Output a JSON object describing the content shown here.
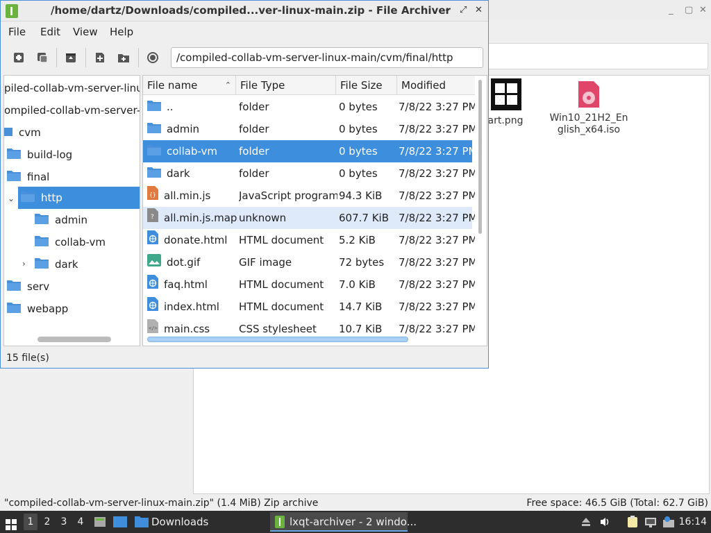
{
  "background_window": {
    "files": [
      {
        "name": "art.png",
        "icon": "windows-logo-image-icon"
      },
      {
        "name": "Win10_21H2_English_x64.iso",
        "line1": "Win10_21H2_En",
        "line2": "glish_x64.iso",
        "icon": "disc-image-icon"
      }
    ],
    "status_left": "\"compiled-collab-vm-server-linux-main.zip\" (1.4 MiB) Zip archive",
    "status_right": "Free space: 46.5 GiB (Total: 62.7 GiB)"
  },
  "archiver": {
    "title": "/home/dartz/Downloads/compiled...ver-linux-main.zip - File Archiver",
    "menu": [
      "File",
      "Edit",
      "View",
      "Help"
    ],
    "path": "/compiled-collab-vm-server-linux-main/cvm/final/http",
    "tree": [
      {
        "label": "piled-collab-vm-server-linux-m",
        "depth": 0,
        "icon": false
      },
      {
        "label": "ompiled-collab-vm-server-linu",
        "depth": 0,
        "icon": false
      },
      {
        "label": "cvm",
        "depth": 0,
        "icon": false
      },
      {
        "label": "build-log",
        "depth": 0,
        "icon": true
      },
      {
        "label": "final",
        "depth": 0,
        "icon": true
      },
      {
        "label": "http",
        "depth": 1,
        "icon": true,
        "selected": true
      },
      {
        "label": "admin",
        "depth": 2,
        "icon": true
      },
      {
        "label": "collab-vm",
        "depth": 2,
        "icon": true
      },
      {
        "label": "dark",
        "depth": 2,
        "icon": true
      },
      {
        "label": "serv",
        "depth": 0,
        "icon": true
      },
      {
        "label": "webapp",
        "depth": 0,
        "icon": true
      }
    ],
    "columns": [
      "File name",
      "File Type",
      "File Size",
      "Modified"
    ],
    "files": [
      {
        "name": "..",
        "type": "folder",
        "size": "0 bytes",
        "modified": "7/8/22 3:27 PM",
        "icon": "folder-icon"
      },
      {
        "name": "admin",
        "type": "folder",
        "size": "0 bytes",
        "modified": "7/8/22 3:27 PM",
        "icon": "folder-icon"
      },
      {
        "name": "collab-vm",
        "type": "folder",
        "size": "0 bytes",
        "modified": "7/8/22 3:27 PM",
        "icon": "folder-icon"
      },
      {
        "name": "dark",
        "type": "folder",
        "size": "0 bytes",
        "modified": "7/8/22 3:27 PM",
        "icon": "folder-icon"
      },
      {
        "name": "all.min.js",
        "type": "JavaScript program",
        "size": "94.3 KiB",
        "modified": "7/8/22 3:27 PM",
        "icon": "javascript-file-icon"
      },
      {
        "name": "all.min.js.map",
        "type": "unknown",
        "size": "607.7 KiB",
        "modified": "7/8/22 3:27 PM",
        "icon": "unknown-file-icon"
      },
      {
        "name": "donate.html",
        "type": "HTML document",
        "size": "5.2 KiB",
        "modified": "7/8/22 3:27 PM",
        "icon": "html-file-icon"
      },
      {
        "name": "dot.gif",
        "type": "GIF image",
        "size": "72 bytes",
        "modified": "7/8/22 3:27 PM",
        "icon": "image-file-icon"
      },
      {
        "name": "faq.html",
        "type": "HTML document",
        "size": "7.0 KiB",
        "modified": "7/8/22 3:27 PM",
        "icon": "html-file-icon"
      },
      {
        "name": "index.html",
        "type": "HTML document",
        "size": "14.7 KiB",
        "modified": "7/8/22 3:27 PM",
        "icon": "html-file-icon"
      },
      {
        "name": "main.css",
        "type": "CSS stylesheet",
        "size": "10.7 KiB",
        "modified": "7/8/22 3:27 PM",
        "icon": "css-file-icon"
      }
    ],
    "status": "15 file(s)"
  },
  "taskbar": {
    "desktops": [
      "1",
      "2",
      "3",
      "4"
    ],
    "tasks": [
      {
        "label": "Downloads",
        "icon": "folder-icon"
      },
      {
        "label": "lxqt-archiver - 2 windo...",
        "icon": "archiver-icon"
      }
    ],
    "clock": "16:14"
  },
  "colors": {
    "selection": "#3e8ede",
    "folder": "#4a90d9",
    "taskbar": "#2d2d2d"
  }
}
